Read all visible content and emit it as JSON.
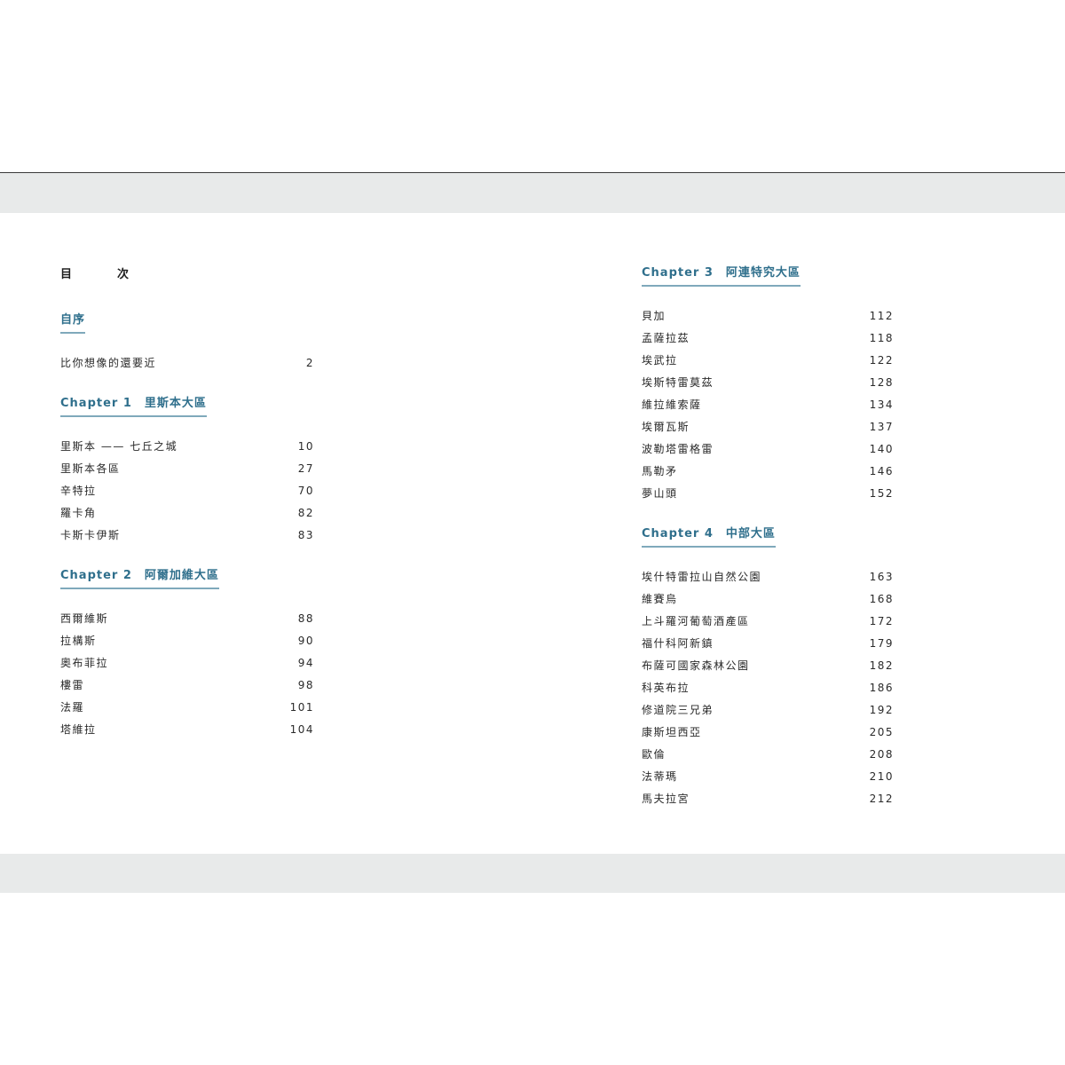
{
  "toc_title": "目　次",
  "left_sections": [
    {
      "chapter_label": "",
      "title": "自序",
      "entries": [
        {
          "name": "比你想像的還要近",
          "page": "2"
        }
      ]
    },
    {
      "chapter_label": "Chapter 1",
      "title": "里斯本大區",
      "entries": [
        {
          "name": "里斯本 —— 七丘之城",
          "page": "10"
        },
        {
          "name": "里斯本各區",
          "page": "27"
        },
        {
          "name": "辛特拉",
          "page": "70"
        },
        {
          "name": "羅卡角",
          "page": "82"
        },
        {
          "name": "卡斯卡伊斯",
          "page": "83"
        }
      ]
    },
    {
      "chapter_label": "Chapter 2",
      "title": "阿爾加維大區",
      "entries": [
        {
          "name": "西爾維斯",
          "page": "88"
        },
        {
          "name": "拉構斯",
          "page": "90"
        },
        {
          "name": "奧布菲拉",
          "page": "94"
        },
        {
          "name": "樓雷",
          "page": "98"
        },
        {
          "name": "法羅",
          "page": "101"
        },
        {
          "name": "塔維拉",
          "page": "104"
        }
      ]
    }
  ],
  "right_sections": [
    {
      "chapter_label": "Chapter 3",
      "title": "阿連特究大區",
      "entries": [
        {
          "name": "貝加",
          "page": "112"
        },
        {
          "name": "孟薩拉茲",
          "page": "118"
        },
        {
          "name": "埃武拉",
          "page": "122"
        },
        {
          "name": "埃斯特雷莫茲",
          "page": "128"
        },
        {
          "name": "維拉維索薩",
          "page": "134"
        },
        {
          "name": "埃爾瓦斯",
          "page": "137"
        },
        {
          "name": "波勒塔雷格雷",
          "page": "140"
        },
        {
          "name": "馬勒矛",
          "page": "146"
        },
        {
          "name": "夢山頭",
          "page": "152"
        }
      ]
    },
    {
      "chapter_label": "Chapter 4",
      "title": "中部大區",
      "entries": [
        {
          "name": "埃什特雷拉山自然公園",
          "page": "163"
        },
        {
          "name": "維賽烏",
          "page": "168"
        },
        {
          "name": "上斗羅河葡萄酒產區",
          "page": "172"
        },
        {
          "name": "福什科阿新鎮",
          "page": "179"
        },
        {
          "name": "布薩可國家森林公園",
          "page": "182"
        },
        {
          "name": "科英布拉",
          "page": "186"
        },
        {
          "name": "修道院三兄弟",
          "page": "192"
        },
        {
          "name": "康斯坦西亞",
          "page": "205"
        },
        {
          "name": "歐倫",
          "page": "208"
        },
        {
          "name": "法蒂瑪",
          "page": "210"
        },
        {
          "name": "馬夫拉宮",
          "page": "212"
        }
      ]
    }
  ],
  "colors": {
    "heading": "#2f6f8c",
    "heading_rule": "#7fa9bb",
    "band": "#e8eaea",
    "text": "#2a2a2a"
  }
}
